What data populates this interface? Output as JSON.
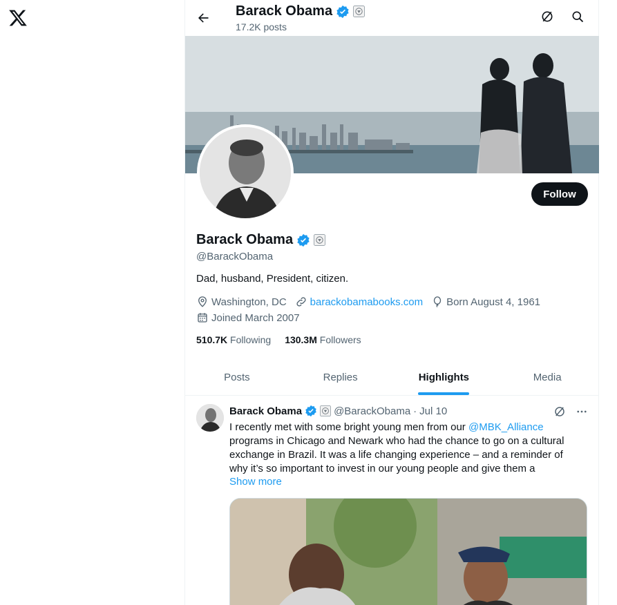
{
  "nav": {
    "logo_icon": "x-logo-icon"
  },
  "header": {
    "name": "Barack Obama",
    "posts_count": "17.2K posts"
  },
  "profile": {
    "name": "Barack Obama",
    "handle": "@BarackObama",
    "bio": "Dad, husband, President, citizen.",
    "location": "Washington, DC",
    "website": "barackobamabooks.com",
    "birth": "Born August 4, 1961",
    "joined": "Joined March 2007",
    "following_count": "510.7K",
    "following_label": "Following",
    "followers_count": "130.3M",
    "followers_label": "Followers",
    "follow_label": "Follow"
  },
  "tabs": [
    {
      "label": "Posts"
    },
    {
      "label": "Replies"
    },
    {
      "label": "Highlights",
      "active": true
    },
    {
      "label": "Media"
    }
  ],
  "tweet": {
    "author": "Barack Obama",
    "handle": "@BarackObama",
    "separator": "·",
    "date": "Jul 10",
    "text_prefix": "I recently met with some bright young men from our ",
    "mention": "@MBK_Alliance",
    "line2": "programs in Chicago and Newark who had the chance to go on a cultural",
    "line3": "exchange in Brazil. It was a life changing experience – and a reminder of",
    "line4": "why it’s so important to invest in our young people and give them a",
    "show_more": "Show more"
  },
  "colors": {
    "accent": "#1d9bf0",
    "text": "#0f1419",
    "muted": "#536471"
  }
}
